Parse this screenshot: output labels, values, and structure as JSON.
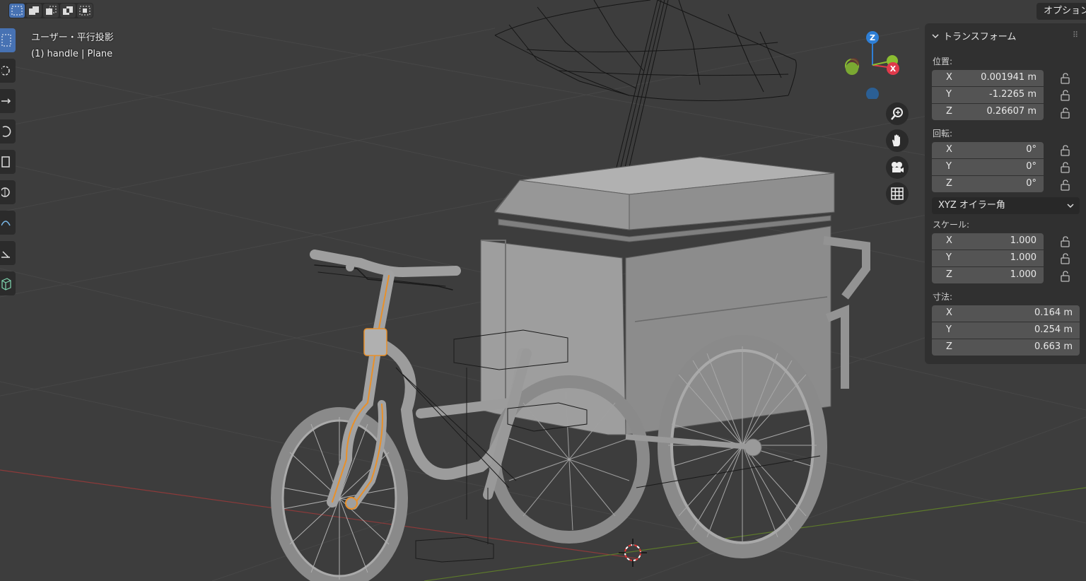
{
  "header": {
    "selection_modes": [
      "select-new-icon",
      "select-extend-icon",
      "select-subtract-icon",
      "select-difference-icon",
      "select-intersect-icon"
    ],
    "options_label": "オプション"
  },
  "viewport": {
    "view_name": "ユーザー・平行投影",
    "object_info": "(1) handle | Plane"
  },
  "toolbar": {
    "tools": [
      "select-box-icon",
      "cursor-icon",
      "move-icon",
      "rotate-icon",
      "scale-icon",
      "transform-icon",
      "annotate-icon",
      "measure-icon",
      "add-cube-icon"
    ]
  },
  "gizmo": {
    "axes": [
      "Z",
      "Y",
      "X"
    ],
    "colors": {
      "x": "#e03a4b",
      "y": "#8bbd31",
      "z": "#2e7fd6",
      "neg_z": "#2b5f94"
    }
  },
  "nav_buttons": [
    "zoom-icon",
    "pan-hand-icon",
    "camera-icon",
    "grid-icon"
  ],
  "transform_panel": {
    "title": "トランスフォーム",
    "location": {
      "label": "位置:",
      "x": {
        "axis": "X",
        "value": "0.001941 m"
      },
      "y": {
        "axis": "Y",
        "value": "-1.2265 m"
      },
      "z": {
        "axis": "Z",
        "value": "0.26607 m"
      }
    },
    "rotation": {
      "label": "回転:",
      "x": {
        "axis": "X",
        "value": "0°"
      },
      "y": {
        "axis": "Y",
        "value": "0°"
      },
      "z": {
        "axis": "Z",
        "value": "0°"
      },
      "mode": "XYZ オイラー角"
    },
    "scale": {
      "label": "スケール:",
      "x": {
        "axis": "X",
        "value": "1.000"
      },
      "y": {
        "axis": "Y",
        "value": "1.000"
      },
      "z": {
        "axis": "Z",
        "value": "1.000"
      }
    },
    "dimensions": {
      "label": "寸法:",
      "x": {
        "axis": "X",
        "value": "0.164 m"
      },
      "y": {
        "axis": "Y",
        "value": "0.254 m"
      },
      "z": {
        "axis": "Z",
        "value": "0.663 m"
      }
    }
  },
  "colors": {
    "accent": "#4772b3",
    "selection_outline": "#e8902a",
    "background": "#3d3d3d"
  }
}
